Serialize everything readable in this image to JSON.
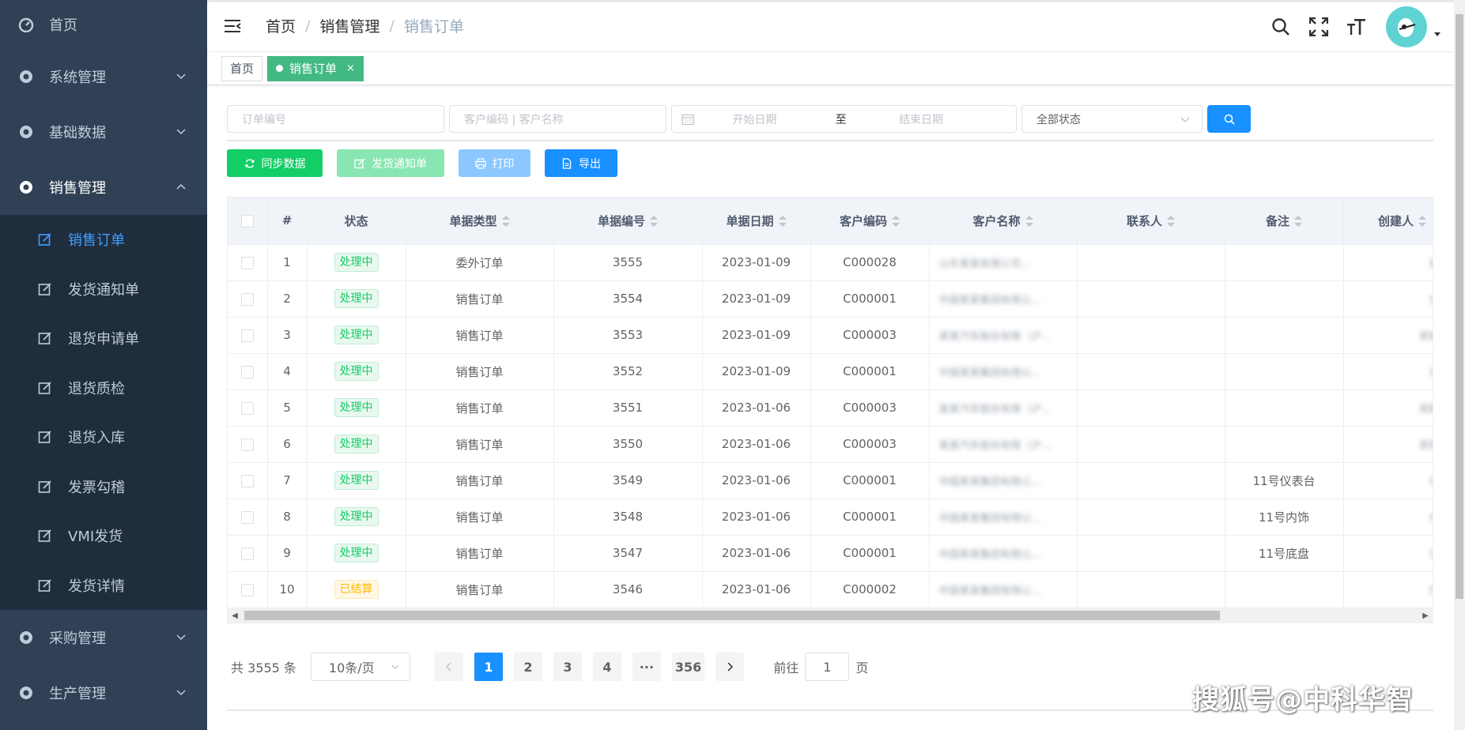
{
  "sidebar": {
    "home": "首页",
    "system": "系统管理",
    "basic": "基础数据",
    "sales": "销售管理",
    "sub": [
      "销售订单",
      "发货通知单",
      "退货申请单",
      "退货质检",
      "退货入库",
      "发票勾稽",
      "VMI发货",
      "发货详情"
    ],
    "purchase": "采购管理",
    "production": "生产管理"
  },
  "breadcrumb": {
    "home": "首页",
    "sep": "/",
    "module": "销售管理",
    "page": "销售订单"
  },
  "tags": {
    "home": "首页",
    "current": "销售订单",
    "close": "×"
  },
  "filters": {
    "order_no": "订单编号",
    "customer": "客户编码 | 客户名称",
    "start_date": "开始日期",
    "to": "至",
    "end_date": "结束日期",
    "status": "全部状态"
  },
  "buttons": {
    "sync": "同步数据",
    "notice": "发货通知单",
    "print": "打印",
    "export": "导出"
  },
  "table": {
    "headers": [
      "#",
      "状态",
      "单据类型",
      "单据编号",
      "单据日期",
      "客户编码",
      "客户名称",
      "联系人",
      "备注",
      "创建人"
    ],
    "rows": [
      {
        "idx": "1",
        "status": "处理中",
        "type": "委外订单",
        "no": "3555",
        "date": "2023-01-09",
        "code": "C000028",
        "name": "山东某某有限公司...",
        "contact": "",
        "remark": "",
        "creator": "某某"
      },
      {
        "idx": "2",
        "status": "处理中",
        "type": "销售订单",
        "no": "3554",
        "date": "2023-01-09",
        "code": "C000001",
        "name": "中国某某集团有限公...",
        "contact": "",
        "remark": "",
        "creator": "刘某"
      },
      {
        "idx": "3",
        "status": "处理中",
        "type": "销售订单",
        "no": "3553",
        "date": "2023-01-09",
        "code": "C000003",
        "name": "某某汽车股份有限（沪...",
        "contact": "",
        "remark": "",
        "creator": "郑某某"
      },
      {
        "idx": "4",
        "status": "处理中",
        "type": "销售订单",
        "no": "3552",
        "date": "2023-01-09",
        "code": "C000001",
        "name": "中国某某集团有限公...",
        "contact": "",
        "remark": "",
        "creator": "刘某"
      },
      {
        "idx": "5",
        "status": "处理中",
        "type": "销售订单",
        "no": "3551",
        "date": "2023-01-06",
        "code": "C000003",
        "name": "某某汽车股份有限（沪...",
        "contact": "",
        "remark": "",
        "creator": "郑某某"
      },
      {
        "idx": "6",
        "status": "处理中",
        "type": "销售订单",
        "no": "3550",
        "date": "2023-01-06",
        "code": "C000003",
        "name": "某某汽车股份有限（沪...",
        "contact": "",
        "remark": "",
        "creator": "郑某某"
      },
      {
        "idx": "7",
        "status": "处理中",
        "type": "销售订单",
        "no": "3549",
        "date": "2023-01-06",
        "code": "C000001",
        "name": "中国某某集团有限公...",
        "contact": "",
        "remark": "11号仪表台",
        "creator": "刘某"
      },
      {
        "idx": "8",
        "status": "处理中",
        "type": "销售订单",
        "no": "3548",
        "date": "2023-01-06",
        "code": "C000001",
        "name": "中国某某集团有限公...",
        "contact": "",
        "remark": "11号内饰",
        "creator": "刘某"
      },
      {
        "idx": "9",
        "status": "处理中",
        "type": "销售订单",
        "no": "3547",
        "date": "2023-01-06",
        "code": "C000001",
        "name": "中国某某集团有限公...",
        "contact": "",
        "remark": "11号底盘",
        "creator": "刘某"
      },
      {
        "idx": "10",
        "status": "已结算",
        "type": "销售订单",
        "no": "3546",
        "date": "2023-01-06",
        "code": "C000002",
        "name": "中国某某集团有限公...",
        "contact": "",
        "remark": "",
        "creator": "刘某"
      }
    ]
  },
  "pagination": {
    "total": "共 3555 条",
    "size": "10条/页",
    "pages": [
      "1",
      "2",
      "3",
      "4",
      "···",
      "356"
    ],
    "goto_prefix": "前往",
    "goto_value": "1",
    "goto_suffix": "页"
  },
  "watermark": "搜狐号@中科华智",
  "colors": {
    "sidebar": "#304156",
    "primary": "#1890ff",
    "success": "#13ce66",
    "tag_active": "#42b983"
  }
}
